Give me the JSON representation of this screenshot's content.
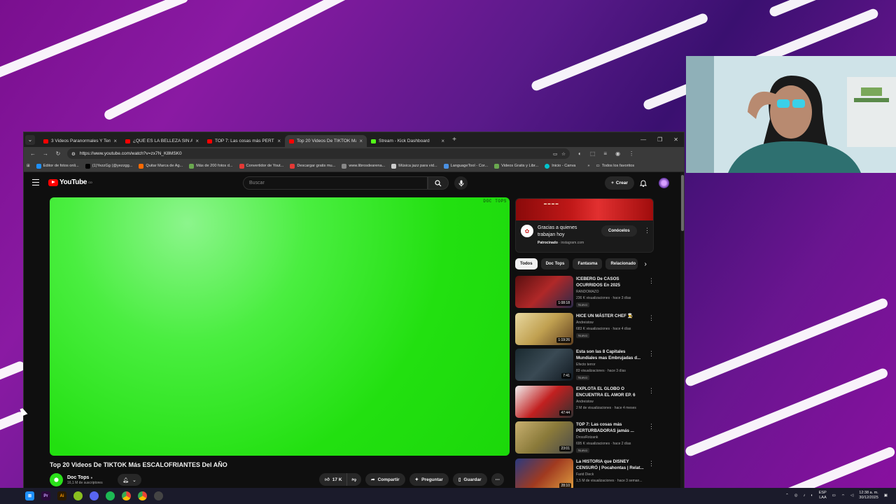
{
  "browser": {
    "tabs": [
      {
        "title": "3 Videos Paranormales Y Terror",
        "favicon_color": "#ff0000",
        "active": false
      },
      {
        "title": "¿QUÉ ES LA BELLEZA SIN ALMA",
        "favicon_color": "#ff0000",
        "active": false
      },
      {
        "title": "TOP 7: Las cosas más PERTURB",
        "favicon_color": "#ff0000",
        "active": false
      },
      {
        "title": "Top 20 Videos De TIKTOK Más",
        "favicon_color": "#ff0000",
        "active": true
      },
      {
        "title": "Stream - Kick Dashboard",
        "favicon_color": "#53fc18",
        "active": false
      }
    ],
    "url": "https://www.youtube.com/watch?v=zx7N_K8MSK0",
    "bookmarks": [
      {
        "label": "Editor de fotos onli...",
        "color": "#1e90ff"
      },
      {
        "label": "(1)YezzGg (@yezzgg...",
        "color": "#000000"
      },
      {
        "label": "Quitar Marca de Ag...",
        "color": "#ff6a00"
      },
      {
        "label": "Más de 200 fotos d...",
        "color": "#6aa84f"
      },
      {
        "label": "Convertidor de Yout...",
        "color": "#e53935"
      },
      {
        "label": "Descargar gratis mu...",
        "color": "#e53935"
      },
      {
        "label": "www.librosdearena...",
        "color": "#888888"
      },
      {
        "label": "Música jazz para vid...",
        "color": "#cccccc"
      },
      {
        "label": "LanguageTool - Cor...",
        "color": "#4a90e2"
      },
      {
        "label": "Videos Gratis y Libr...",
        "color": "#6aa84f"
      },
      {
        "label": "Inicio - Canva",
        "color": "#00c4cc"
      }
    ],
    "all_bookmarks": "Todos los favoritos"
  },
  "youtube": {
    "logo": "YouTube",
    "logo_country": "CO",
    "search_placeholder": "Buscar",
    "create_label": "Crear",
    "watermark": "DOC TOPS",
    "video_title": "Top 20 Videos De TIKTOK Más ESCALOFRIANTES Del AÑO",
    "channel": {
      "name": "Doc Tops",
      "subscribers": "16,1 M de suscriptores"
    },
    "actions": {
      "likes": "17 K",
      "share": "Compartir",
      "ask": "Preguntar",
      "save": "Guardar"
    },
    "ad": {
      "title": "Gracias a quienes trabajan hoy",
      "sponsored": "Patrocinado",
      "domain": "instagram.com",
      "button": "Conócelos"
    },
    "chips": [
      {
        "label": "Todos",
        "active": true
      },
      {
        "label": "Doc Tops"
      },
      {
        "label": "Fantasma"
      },
      {
        "label": "Relacionado"
      }
    ],
    "recommendations": [
      {
        "title": "ICEBERG De CASOS OCURRIDOS En 2025",
        "channel": "RANDOMAZO",
        "meta": "236 K visualizaciones · hace 3 días",
        "badge": "Nuevo",
        "duration": "1:08:18",
        "thumb": "#8b1a1a"
      },
      {
        "title": "HICE UN MÁSTER CHEF 👨‍🍳",
        "channel": "Andreistow",
        "meta": "683 K visualizaciones · hace 4 días",
        "badge": "Nuevo",
        "duration": "1:19:26",
        "thumb": "#c0a050"
      },
      {
        "title": "Esta son las 8 Capitales Mundiales mas Embrujadas d...",
        "channel": "Efecto terror",
        "meta": "83 visualizaciones · hace 3 días",
        "badge": "Nuevo",
        "duration": "7:41",
        "thumb": "#2a3a44"
      },
      {
        "title": "EXPLOTA EL GLOBO O ENCUENTRA EL AMOR EP. 6",
        "channel": "Andreistow",
        "meta": "2 M de visualizaciones · hace 4 meses",
        "badge": "",
        "duration": "47:44",
        "thumb": "#c22020"
      },
      {
        "title": "TOP 7: Las cosas más PERTURBADORAS jamás ...",
        "channel": "DrossRotzank",
        "meta": "695 K visualizaciones · hace 2 días",
        "badge": "Nuevo",
        "duration": "23:01",
        "thumb": "#8a7a3a"
      },
      {
        "title": "La HISTORIA que DISNEY CENSURÓ | Pocahontas | Relat...",
        "channel": "Farid Dieck",
        "meta": "1,5 M de visualizaciones · hace 3 seman...",
        "badge": "",
        "duration": "28:10",
        "thumb": "#a03a20"
      }
    ]
  },
  "taskbar": {
    "lang": "ESP",
    "lang2": "LAA",
    "time": "12:38 a. m.",
    "date": "30/12/2025"
  }
}
